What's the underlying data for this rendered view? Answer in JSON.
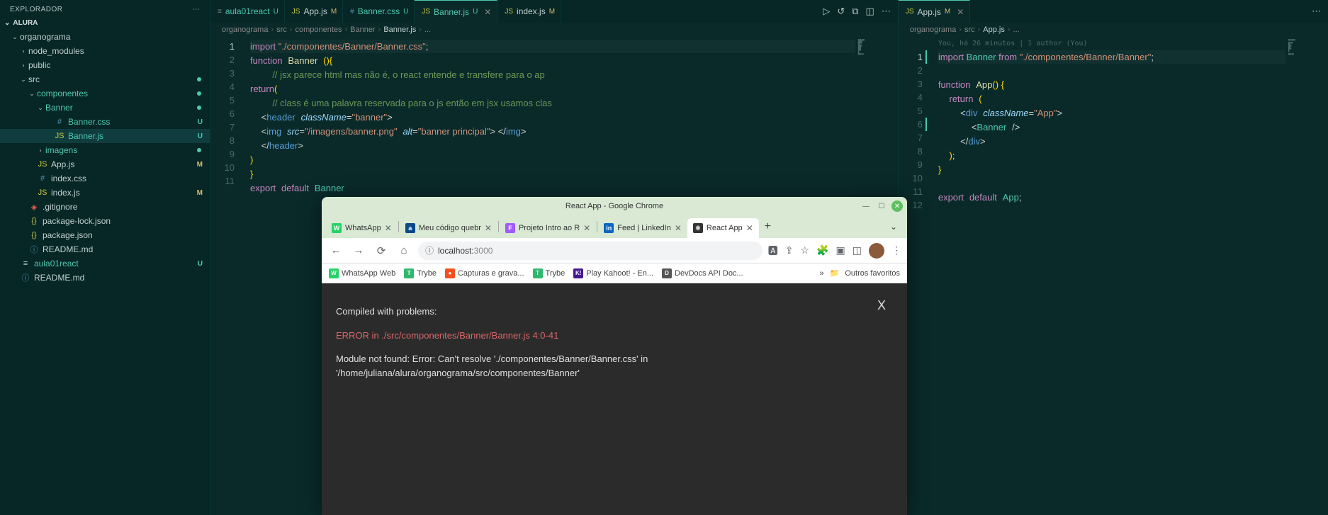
{
  "sidebar": {
    "title": "EXPLORADOR",
    "section": "ALURA",
    "tree": [
      {
        "label": "organograma",
        "type": "folder",
        "depth": 0,
        "expanded": true,
        "teal": false
      },
      {
        "label": "node_modules",
        "type": "folder",
        "depth": 1,
        "expanded": false
      },
      {
        "label": "public",
        "type": "folder",
        "depth": 1,
        "expanded": false
      },
      {
        "label": "src",
        "type": "folder",
        "depth": 1,
        "expanded": true,
        "dot": true
      },
      {
        "label": "componentes",
        "type": "folder",
        "depth": 2,
        "expanded": true,
        "teal": true,
        "dot": true
      },
      {
        "label": "Banner",
        "type": "folder",
        "depth": 3,
        "expanded": true,
        "teal": true,
        "dot": true
      },
      {
        "label": "Banner.css",
        "type": "css",
        "depth": 4,
        "teal": true,
        "badge": "U"
      },
      {
        "label": "Banner.js",
        "type": "js",
        "depth": 4,
        "teal": true,
        "badge": "U",
        "active": true
      },
      {
        "label": "imagens",
        "type": "folder",
        "depth": 3,
        "expanded": false,
        "teal": true,
        "dot": true
      },
      {
        "label": "App.js",
        "type": "js",
        "depth": 2,
        "badge": "M"
      },
      {
        "label": "index.css",
        "type": "css",
        "depth": 2
      },
      {
        "label": "index.js",
        "type": "js",
        "depth": 2,
        "badge": "M"
      },
      {
        "label": ".gitignore",
        "type": "git",
        "depth": 1
      },
      {
        "label": "package-lock.json",
        "type": "json",
        "depth": 1
      },
      {
        "label": "package.json",
        "type": "json",
        "depth": 1
      },
      {
        "label": "README.md",
        "type": "md",
        "depth": 1
      },
      {
        "label": "aula01react",
        "type": "text",
        "depth": 0,
        "teal": true,
        "badge": "U"
      },
      {
        "label": "README.md",
        "type": "md",
        "depth": 0
      }
    ]
  },
  "editor1": {
    "tabs": [
      {
        "label": "aula01react",
        "icon": "≡",
        "status": "U",
        "teal": true
      },
      {
        "label": "App.js",
        "icon": "JS",
        "status": "M"
      },
      {
        "label": "Banner.css",
        "icon": "#",
        "teal": true,
        "status": "U"
      },
      {
        "label": "Banner.js",
        "icon": "JS",
        "teal": true,
        "status": "U",
        "active": true,
        "close": true
      },
      {
        "label": "index.js",
        "icon": "JS",
        "status": "M"
      }
    ],
    "breadcrumb": [
      "organograma",
      "src",
      "componentes",
      "Banner",
      "Banner.js",
      "..."
    ],
    "lines": 11
  },
  "editor2": {
    "tabs": [
      {
        "label": "App.js",
        "icon": "JS",
        "status": "M",
        "active": true,
        "close": true
      }
    ],
    "breadcrumb": [
      "organograma",
      "src",
      "App.js",
      "..."
    ],
    "blame": "You, há 26 minutos | 1 author (You)",
    "lines": 12
  },
  "chrome": {
    "title": "React App - Google Chrome",
    "tabs": [
      {
        "label": "WhatsApp",
        "favbg": "#25d366",
        "favtxt": "W"
      },
      {
        "label": "Meu código quebr",
        "favbg": "#0a4a8a",
        "favtxt": "a"
      },
      {
        "label": "Projeto Intro ao R",
        "favbg": "#a259ff",
        "favtxt": "F"
      },
      {
        "label": "Feed | LinkedIn",
        "favbg": "#0a66c2",
        "favtxt": "in"
      },
      {
        "label": "React App",
        "favbg": "#333",
        "favtxt": "⚛",
        "active": true
      }
    ],
    "url_host": "localhost:",
    "url_port": "3000",
    "bookmarks": [
      {
        "label": "WhatsApp Web",
        "bg": "#25d366",
        "t": "W"
      },
      {
        "label": "Trybe",
        "bg": "#2fb86e",
        "t": "T"
      },
      {
        "label": "Capturas e grava...",
        "bg": "#f25022",
        "t": "●"
      },
      {
        "label": "Trybe",
        "bg": "#2fb86e",
        "t": "T"
      },
      {
        "label": "Play Kahoot! - En...",
        "bg": "#46178f",
        "t": "K!"
      },
      {
        "label": "DevDocs API Doc...",
        "bg": "#555",
        "t": "D"
      }
    ],
    "other_bookmarks": "Outros favoritos",
    "error_heading": "Compiled with problems:",
    "error_line": "ERROR in ./src/componentes/Banner/Banner.js 4:0-41",
    "error_body1": "Module not found: Error: Can't resolve './componentes/Banner/Banner.css' in",
    "error_body2": "'/home/juliana/alura/organograma/src/componentes/Banner'"
  }
}
